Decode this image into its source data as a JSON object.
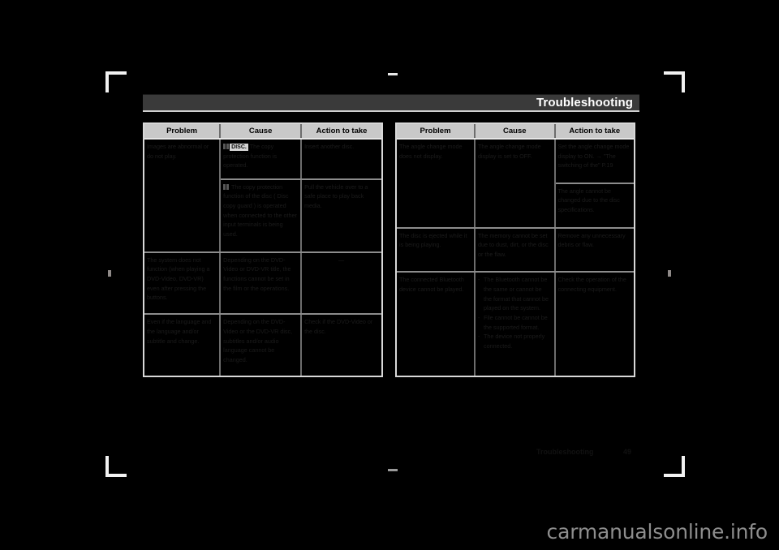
{
  "page": {
    "section_title": "Troubleshooting",
    "footer_label": "Troubleshooting",
    "footer_page": "49",
    "watermark": "carmanualsonline.info",
    "background_color": "#000000",
    "title_bar_color": "#3a3a3a",
    "header_cell_color": "#c9c9c9",
    "border_color": "#d8d8d8",
    "body_text_color": "#1b1b1b"
  },
  "tables": [
    {
      "id": "left",
      "headers": [
        "Problem",
        "Cause",
        "Action to take"
      ],
      "rows": [
        {
          "problem": "Images are abnormal or do not play.",
          "problem_rowspan": 2,
          "cause_pre_glyph": true,
          "cause_chip": "DISC.",
          "cause": "The copy protection function is operated.",
          "action": "Insert another disc."
        },
        {
          "cause_pre_glyph": true,
          "cause_chip": "",
          "cause": "The copy protection function of the disc ( Disc copy guard ) is operated when connected to the other input terminals is being used.",
          "action": "Pull the vehicle over to a safe place to play back media."
        },
        {
          "problem": "The system does not function (when playing a DVD-Video, DVD-VR) even after pressing the buttons.",
          "cause": "Depending on the DVD-Video or DVD-VR title, the functions cannot be set in the film or the operations.",
          "action": "—",
          "action_is_dash": true
        },
        {
          "problem": "Even if the language and the language and/or subtitle and change.",
          "cause": "Depending on the DVD-Video or the DVD-VR disc, subtitles and/or audio language cannot be changed.",
          "action": "Check if the DVD-Video or the disc."
        }
      ]
    },
    {
      "id": "right",
      "headers": [
        "Problem",
        "Cause",
        "Action to take"
      ],
      "rows": [
        {
          "problem": "The angle change mode does not display.",
          "problem_rowspan": 2,
          "cause": "The angle change mode display is set to OFF.",
          "cause_rowspan": 2,
          "action": "Set the angle change mode display to ON. → \"The switching of the\" P.19"
        },
        {
          "action": "The angle cannot be changed due to the disc specifications."
        },
        {
          "problem": "The disc is ejected while it is being playing.",
          "cause": "The memory cannot be set due to dust, dirt, or the disc or the flaw.",
          "action": "Remove any unnecessary debris or flaw."
        },
        {
          "problem": "The connected Bluetooth device cannot be played.",
          "cause_bullets": [
            "The Bluetooth cannot be the same or cannot be the format that cannot be played on the system.",
            "File cannot be cannot be the supported format.",
            "The device not properly connected."
          ],
          "action": "Check the operation of the connecting equipment."
        }
      ]
    }
  ]
}
